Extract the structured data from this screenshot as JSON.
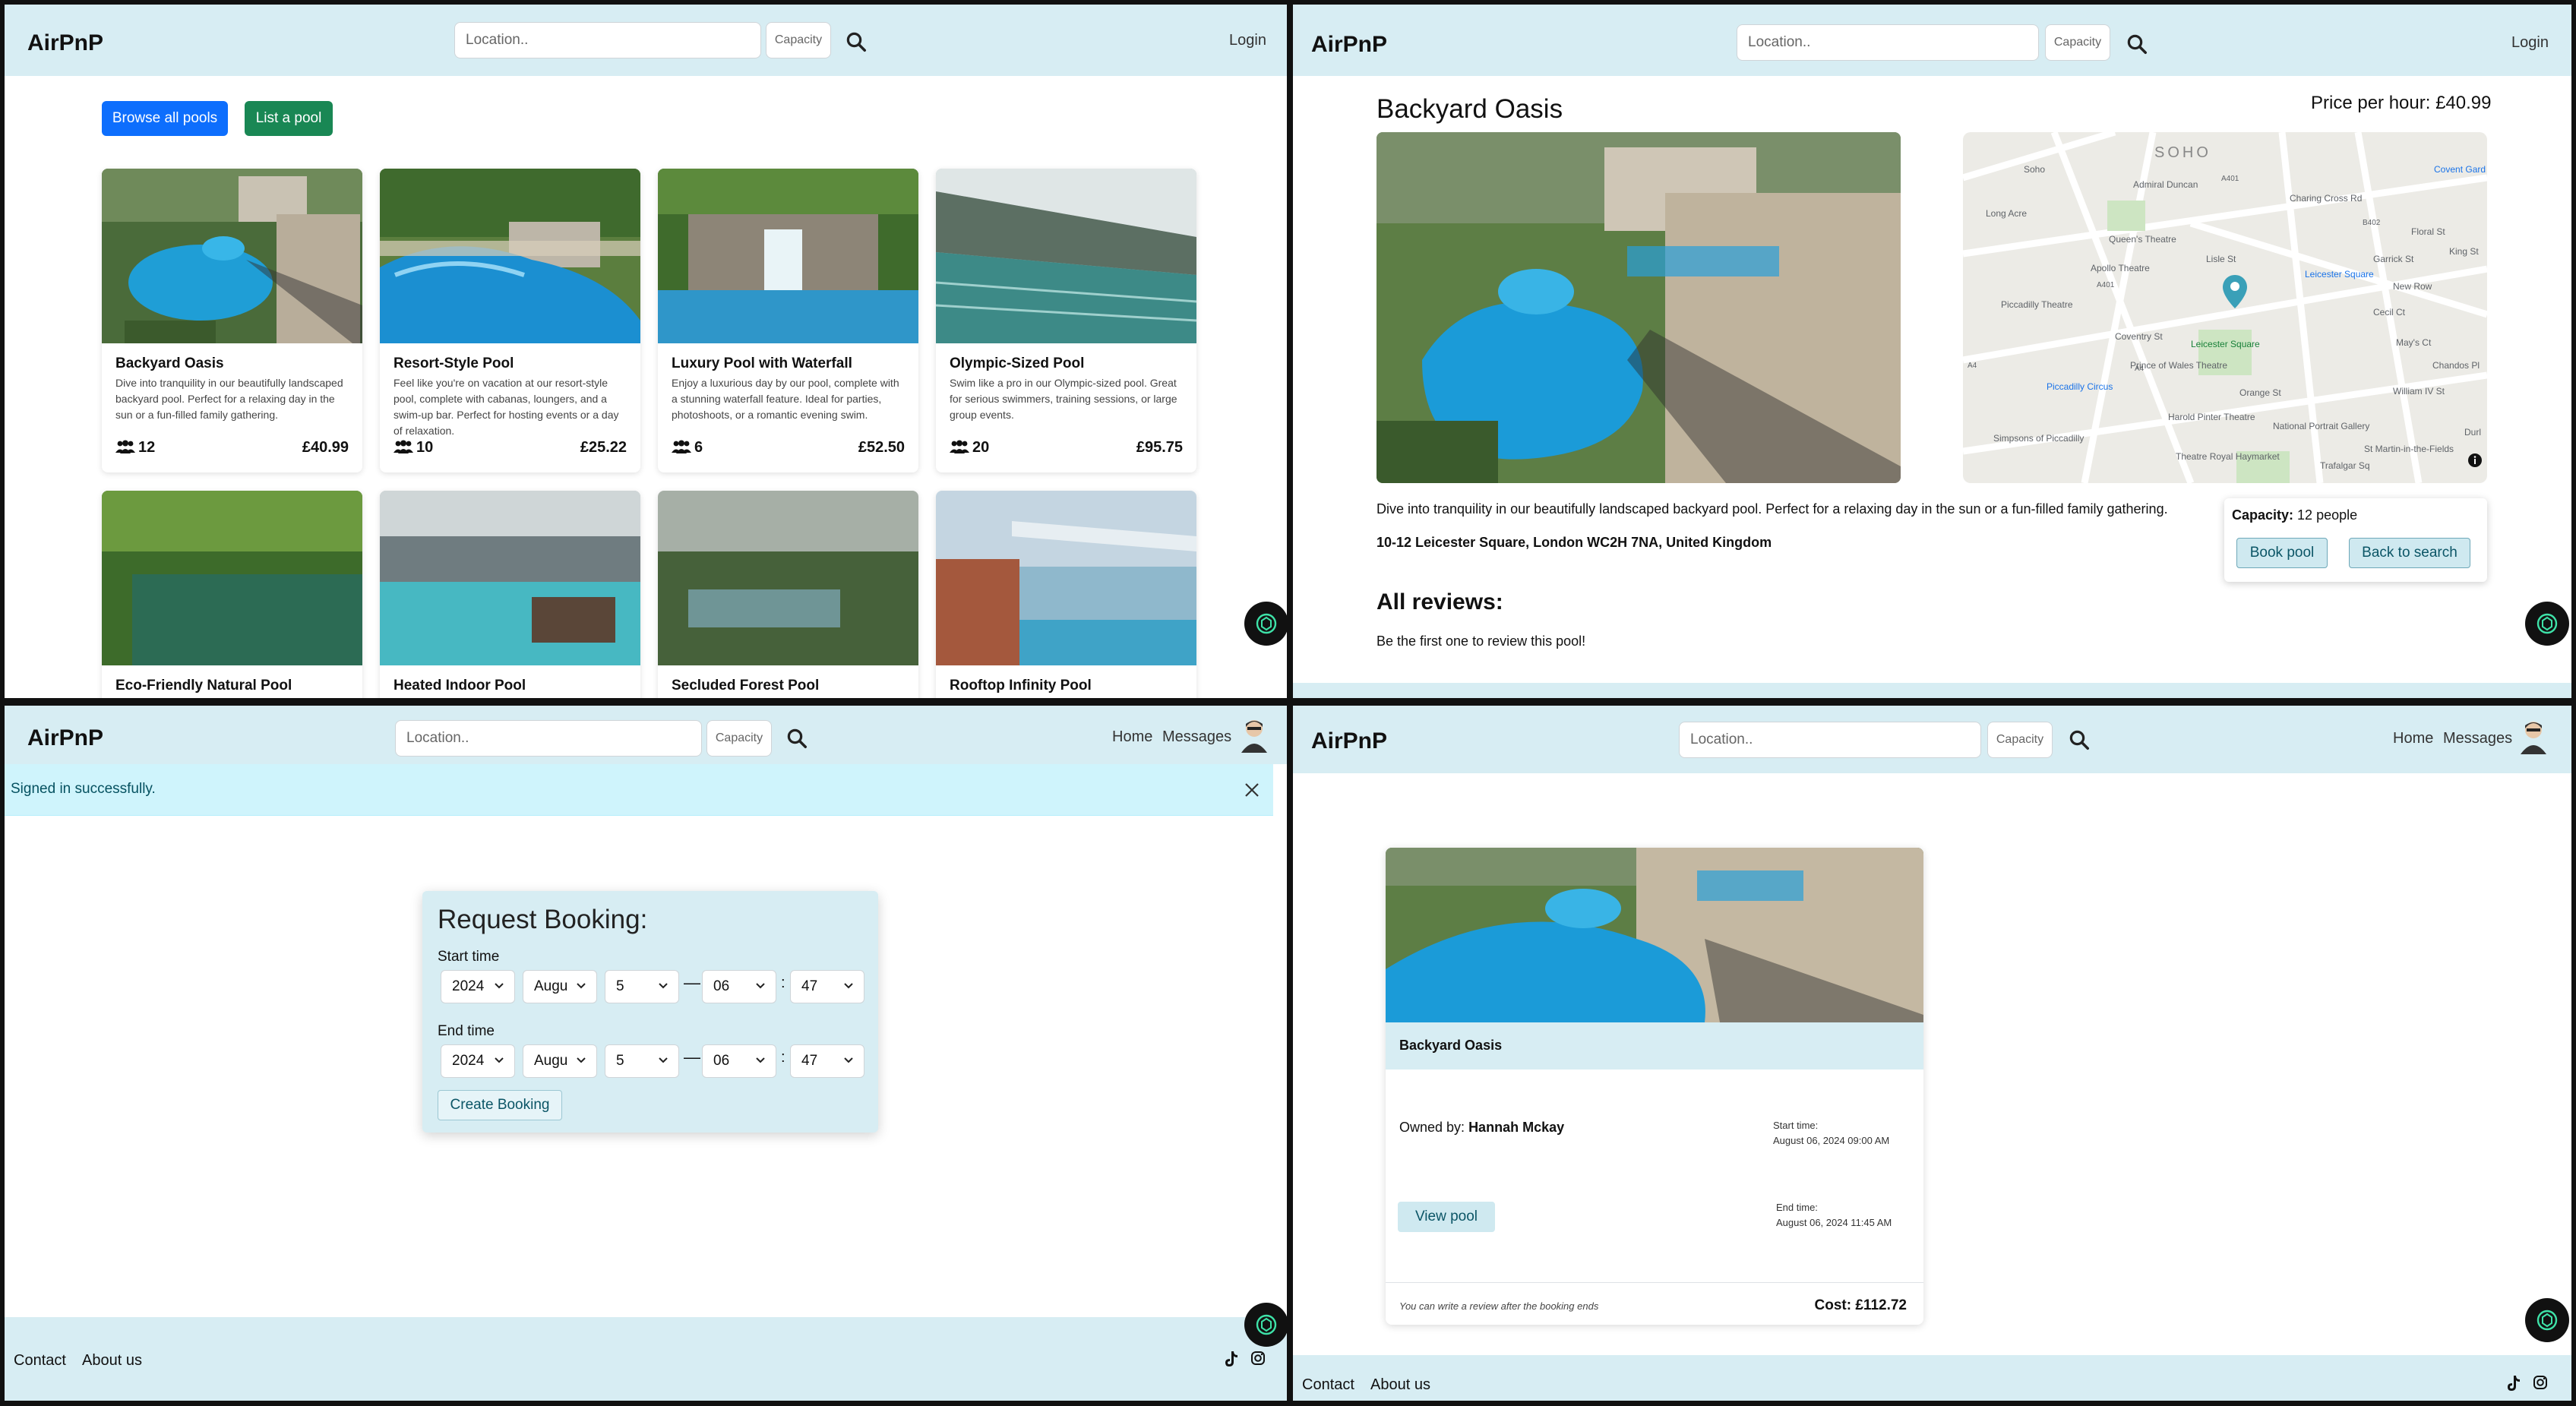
{
  "app": {
    "brand": "AirPnP"
  },
  "search": {
    "location_placeholder": "Location..",
    "capacity_placeholder": "Capacity"
  },
  "nav": {
    "login": "Login",
    "home": "Home",
    "messages": "Messages"
  },
  "listing_page": {
    "browse_button": "Browse all pools",
    "list_button": "List a pool",
    "cards": [
      {
        "title": "Backyard Oasis",
        "description": "Dive into tranquility in our beautifully landscaped backyard pool. Perfect for a relaxing day in the sun or a fun-filled family gathering.",
        "capacity": "12",
        "price": "£40.99"
      },
      {
        "title": "Resort-Style Pool",
        "description": "Feel like you're on vacation at our resort-style pool, complete with cabanas, loungers, and a swim-up bar. Perfect for hosting events or a day of relaxation.",
        "capacity": "10",
        "price": "£25.22"
      },
      {
        "title": "Luxury Pool with Waterfall",
        "description": "Enjoy a luxurious day by our pool, complete with a stunning waterfall feature. Ideal for parties, photoshoots, or a romantic evening swim.",
        "capacity": "6",
        "price": "£52.50"
      },
      {
        "title": "Olympic-Sized Pool",
        "description": "Swim like a pro in our Olympic-sized pool. Great for serious swimmers, training sessions, or large group events.",
        "capacity": "20",
        "price": "£95.75"
      },
      {
        "title": "Eco-Friendly Natural Pool"
      },
      {
        "title": "Heated Indoor Pool"
      },
      {
        "title": "Secluded Forest Pool"
      },
      {
        "title": "Rooftop Infinity Pool"
      }
    ]
  },
  "detail_page": {
    "title": "Backyard Oasis",
    "price_label": "Price per hour: £40.99",
    "description": "Dive into tranquility in our beautifully landscaped backyard pool. Perfect for a relaxing day in the sun or a fun-filled family gathering.",
    "address": "10-12 Leicester Square, London WC2H 7NA, United Kingdom",
    "capacity_label": "Capacity:",
    "capacity_value": "12 people",
    "book_button": "Book pool",
    "back_button": "Back to search",
    "reviews_heading": "All reviews:",
    "reviews_empty": "Be the first one to review this pool!",
    "map_labels": [
      "SOHO",
      "Soho",
      "Admiral Duncan",
      "Queen's Theatre",
      "Apollo Theatre",
      "Piccadilly Theatre",
      "Leicester Square",
      "Leicester Square",
      "Prince of Wales Theatre",
      "Piccadilly Circus",
      "Harold Pinter Theatre",
      "Theatre Royal Haymarket",
      "Simpsons of Piccadilly",
      "National Portrait Gallery",
      "St Martin-in-the-Fields",
      "Covent Gard",
      "Cecil Ct",
      "New Row",
      "Garrick St",
      "Floral St",
      "King St",
      "May's Ct",
      "William IV St",
      "Chandos Pl",
      "Lisle St",
      "Coventry St",
      "Orange St",
      "Trafalgar Sq",
      "Durl",
      "Charing Cross Rd",
      "Long Acre",
      "A401",
      "A401",
      "B402",
      "A4",
      "A4"
    ]
  },
  "booking_page": {
    "alert": "Signed in successfully.",
    "heading": "Request Booking:",
    "start_label": "Start time",
    "end_label": "End time",
    "start": {
      "year": "2024",
      "month": "Augu",
      "day": "5",
      "hour": "06",
      "minute": "47"
    },
    "end": {
      "year": "2024",
      "month": "Augu",
      "day": "5",
      "hour": "06",
      "minute": "47"
    },
    "create_button": "Create Booking"
  },
  "confirm_page": {
    "pool_title": "Backyard Oasis",
    "owned_by_label": "Owned by:",
    "owner_name": "Hannah Mckay",
    "start_label": "Start time:",
    "start_value": "August 06, 2024 09:00 AM",
    "end_label": "End time:",
    "end_value": "August 06, 2024 11:45 AM",
    "view_button": "View pool",
    "review_note": "You can write a review after the booking ends",
    "cost": "Cost: £112.72"
  },
  "footer": {
    "contact": "Contact",
    "about": "About us"
  },
  "colors": {
    "nav_bg": "#d7edf3",
    "primary": "#0d6efd",
    "success": "#198754",
    "alert_bg": "#cff4fc",
    "chat_accent": "#3ee2a8"
  },
  "icons": [
    "search-icon",
    "users-icon",
    "close-icon",
    "chevron-down-icon",
    "tiktok-icon",
    "instagram-icon",
    "chatgpt-icon",
    "map-pin-icon",
    "info-icon"
  ]
}
